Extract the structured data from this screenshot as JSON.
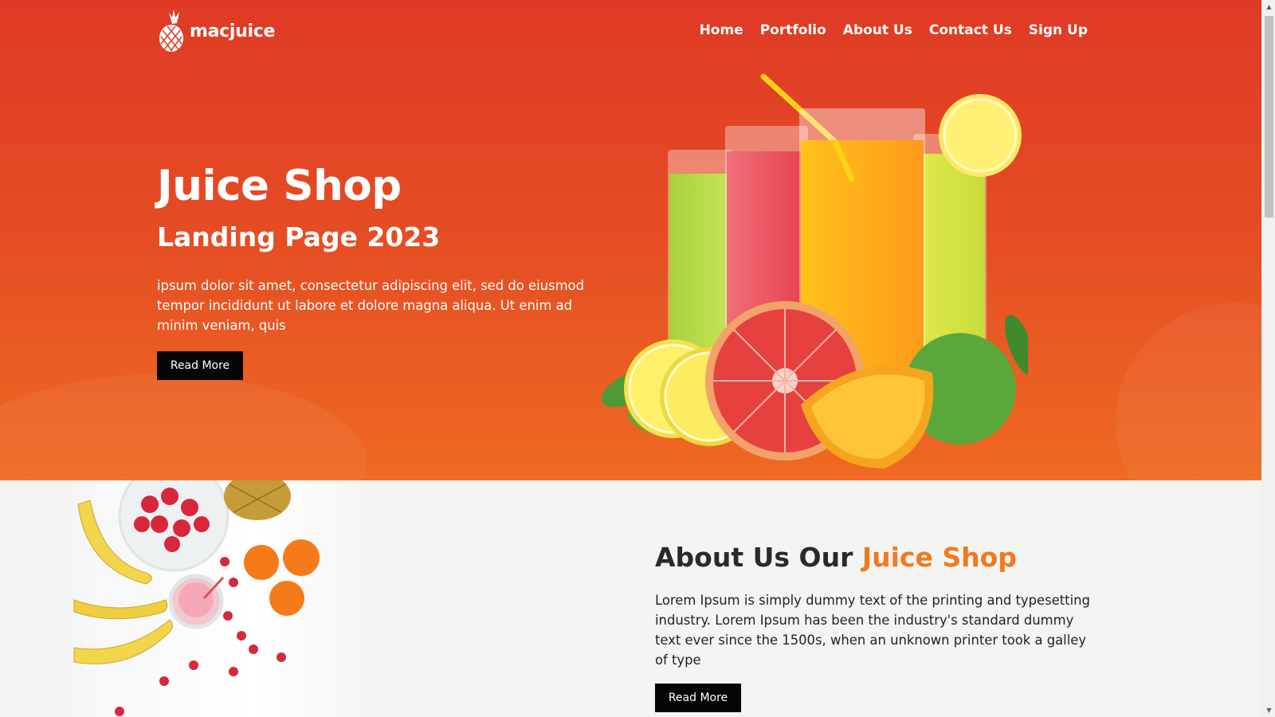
{
  "brand": {
    "name": "macjuice",
    "logo_icon": "pineapple-icon"
  },
  "nav": {
    "items": [
      "Home",
      "Portfolio",
      "About Us",
      "Contact Us",
      "Sign Up"
    ]
  },
  "hero": {
    "title": "Juice Shop",
    "subtitle": "Landing Page 2023",
    "description": "ipsum dolor sit amet, consectetur adipiscing elit, sed do eiusmod tempor incididunt ut labore et dolore magna aliqua. Ut enim ad minim veniam, quis",
    "button_label": "Read More"
  },
  "about": {
    "title_main": "About Us Our ",
    "title_accent": "Juice Shop",
    "description": "Lorem Ipsum is simply dummy text of the printing and typesetting industry. Lorem Ipsum has been the industry's standard dummy text ever since the 1500s, when an unknown printer took a galley of type",
    "button_label": "Read More"
  },
  "colors": {
    "hero_top": "#df3a25",
    "hero_bottom": "#ef6a22",
    "accent": "#f07a20",
    "button": "#050505",
    "background": "#f4f4f3"
  }
}
